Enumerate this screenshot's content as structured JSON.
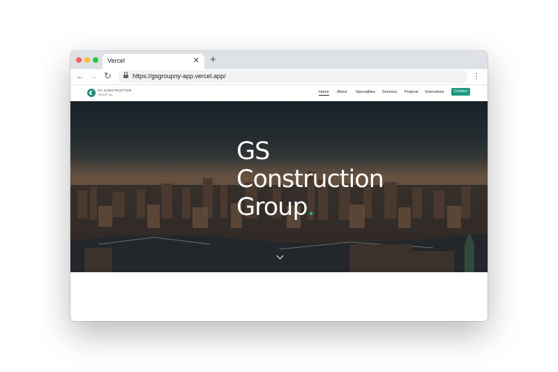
{
  "browser": {
    "tab_title": "Vercel",
    "url": "https://gsgroupny-app.vercel.app/",
    "tab_close_icon": "close-icon",
    "new_tab_icon": "plus-icon"
  },
  "site": {
    "logo": {
      "line1": "GS CONSTRUCTION",
      "line2": "GROUP Inc."
    },
    "nav": [
      {
        "label": "Home",
        "active": true
      },
      {
        "label": "About"
      },
      {
        "label": "Specialities"
      },
      {
        "label": "Services"
      },
      {
        "label": "Projects"
      },
      {
        "label": "Executives"
      }
    ],
    "contact_label": "Contact",
    "hero": {
      "line1": "GS",
      "line2": "Construction",
      "line3": "Group",
      "dot": "."
    }
  },
  "colors": {
    "accent": "#1d9a82",
    "tab_bar": "#dee1e6"
  }
}
